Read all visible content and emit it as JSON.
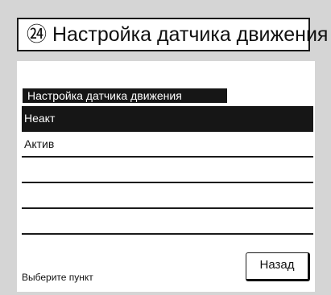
{
  "header": {
    "title": "㉔ Настройка датчика движения"
  },
  "menu": {
    "header": "Настройка датчика движения",
    "items": [
      {
        "label": "Неакт",
        "selected": true
      },
      {
        "label": "Актив",
        "selected": false
      },
      {
        "label": "",
        "selected": false
      },
      {
        "label": "",
        "selected": false
      },
      {
        "label": "",
        "selected": false
      }
    ]
  },
  "footer": {
    "status": "Выберите пункт",
    "back_label": "Назад"
  },
  "colors": {
    "background": "#d5d5d5",
    "panel": "#ffffff",
    "selection": "#161616"
  }
}
